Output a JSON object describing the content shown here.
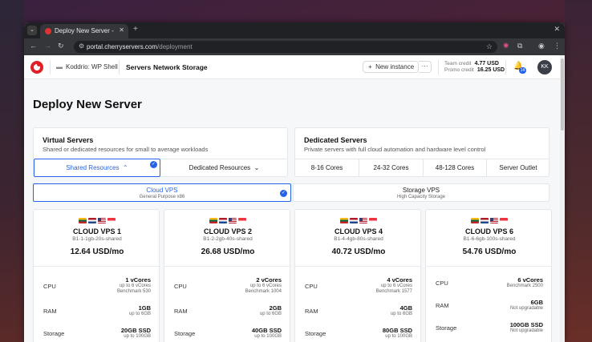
{
  "browser": {
    "tab_title": "Deploy New Server - C",
    "url_host": "portal.cherryservers.com",
    "url_path": "/deployment"
  },
  "header": {
    "project": "Koddrio: WP Shell",
    "nav": [
      "Servers",
      "Network",
      "Storage"
    ],
    "new_instance": "New instance",
    "more": "···",
    "team_credit_label": "Team credit",
    "team_credit_value": "4.77 USD",
    "promo_credit_label": "Promo credit",
    "promo_credit_value": "16.25 USD",
    "notification_count": "14",
    "avatar": "KK"
  },
  "page_title": "Deploy New Server",
  "virtual": {
    "title": "Virtual Servers",
    "subtitle": "Shared or dedicated resources for small to average workloads",
    "options": [
      "Shared Resources",
      "Dedicated Resources"
    ]
  },
  "dedicated": {
    "title": "Dedicated Servers",
    "subtitle": "Private servers with full cloud automation and hardware level control",
    "options": [
      "8-16 Cores",
      "24-32 Cores",
      "48-128 Cores",
      "Server Outlet"
    ]
  },
  "tiers": [
    {
      "title": "Cloud VPS",
      "subtitle": "General Purpose x86"
    },
    {
      "title": "Storage VPS",
      "subtitle": "High Capacity Storage"
    }
  ],
  "spec_labels": {
    "cpu": "CPU",
    "ram": "RAM",
    "storage": "Storage"
  },
  "plans": [
    {
      "name": "CLOUD VPS 1",
      "code": "B1-1-1gb-20s-shared",
      "price": "12.64 USD/mo",
      "cpu": "1 vCores",
      "cpu_note1": "up to 6 vCores",
      "cpu_note2": "Benchmark 530",
      "ram": "1GB",
      "ram_note": "up to 6GB",
      "storage": "20GB SSD",
      "storage_note": "up to 100GB"
    },
    {
      "name": "CLOUD VPS 2",
      "code": "B1-2-2gb-40s-shared",
      "price": "26.68 USD/mo",
      "cpu": "2 vCores",
      "cpu_note1": "up to 6 vCores",
      "cpu_note2": "Benchmark 1004",
      "ram": "2GB",
      "ram_note": "up to 6GB",
      "storage": "40GB SSD",
      "storage_note": "up to 100GB"
    },
    {
      "name": "CLOUD VPS 4",
      "code": "B1-4-4gb-80s-shared",
      "price": "40.72 USD/mo",
      "cpu": "4 vCores",
      "cpu_note1": "up to 6 vCores",
      "cpu_note2": "Benchmark 1577",
      "ram": "4GB",
      "ram_note": "up to 6GB",
      "storage": "80GB SSD",
      "storage_note": "up to 100GB"
    },
    {
      "name": "CLOUD VPS 6",
      "code": "B1-6-6gb-100s-shared",
      "price": "54.76 USD/mo",
      "cpu": "6 vCores",
      "cpu_note1": "Benchmark 2500",
      "cpu_note2": "",
      "ram": "6GB",
      "ram_note": "Not upgradable",
      "storage": "100GB SSD",
      "storage_note": "Not upgradable"
    }
  ],
  "colors": {
    "accent": "#2563eb",
    "brand": "#e21f26"
  }
}
